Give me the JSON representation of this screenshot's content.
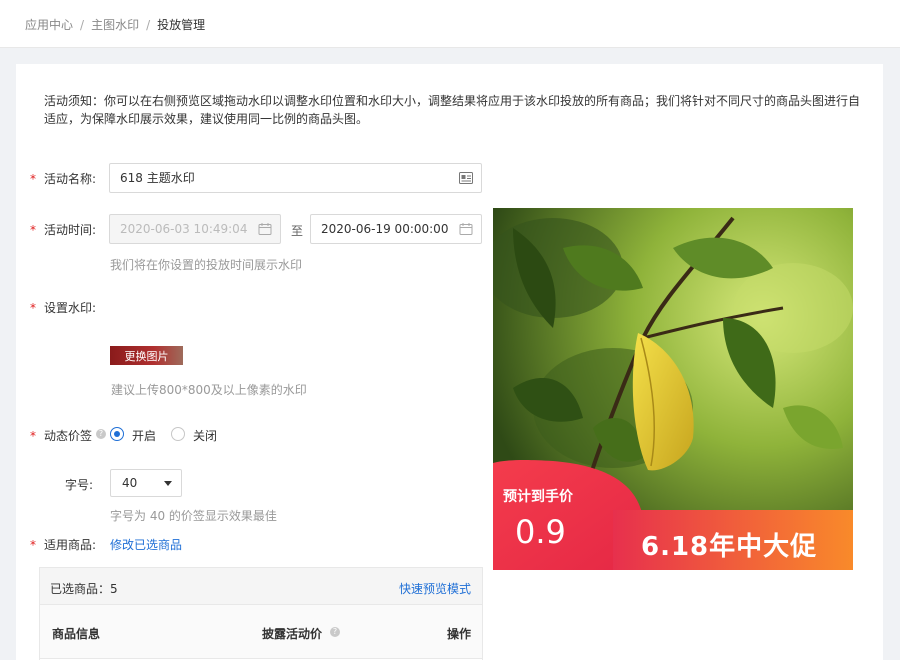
{
  "breadcrumb": [
    "应用中心",
    "主图水印",
    "投放管理"
  ],
  "notice": "活动须知：你可以在右侧预览区域拖动水印以调整水印位置和水印大小，调整结果将应用于该水印投放的所有商品；我们将针对不同尺寸的商品头图进行自适应，为保障水印展示效果，建议使用同一比例的商品头图。",
  "form": {
    "name_label": "活动名称:",
    "name_value": "618 主题水印",
    "time_label": "活动时间:",
    "start_time": "2020-06-03 10:49:04",
    "to_text": "至",
    "end_time": "2020-06-19 00:00:00",
    "time_hint": "我们将在你设置的投放时间展示水印",
    "watermark_label": "设置水印:",
    "replace_image": "更换图片",
    "watermark_hint": "建议上传800*800及以上像素的水印",
    "dynamic_price_label": "动态价签",
    "radio_on": "开启",
    "radio_off": "关闭",
    "dynamic_price_enabled": true,
    "font_size_label": "字号:",
    "font_size_value": "40",
    "font_size_hint": "字号为 40 的价签显示效果最佳",
    "goods_label": "适用商品:",
    "modify_goods_link": "修改已选商品"
  },
  "table": {
    "selected_label": "已选商品：",
    "selected_count": "5",
    "quick_preview": "快速预览模式",
    "columns": [
      "商品信息",
      "披露活动价",
      "操作"
    ]
  },
  "preview": {
    "price_title": "预计到手价",
    "price_value": "0.9",
    "promo_text": "6.18年中大促"
  },
  "colors": {
    "accent": "#1f6fd6",
    "required": "#e02020",
    "promo_red": "#e8334a",
    "promo_orange": "#f7762a"
  }
}
